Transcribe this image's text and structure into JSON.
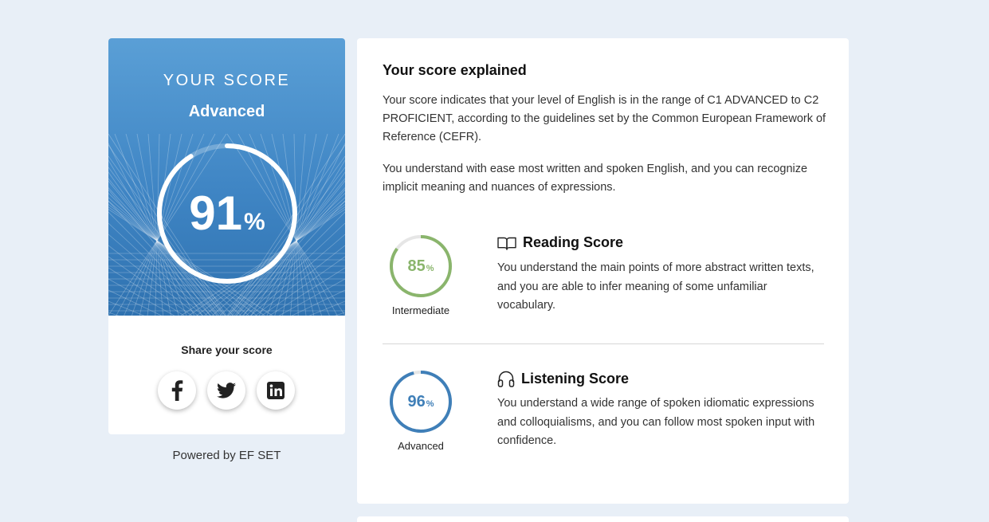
{
  "score_card": {
    "title": "YOUR SCORE",
    "level": "Advanced",
    "score": 91,
    "score_number": "91",
    "score_unit": "%",
    "ring_color": "#ffffff",
    "share_title": "Share your score",
    "share_buttons": [
      {
        "icon": "facebook-icon"
      },
      {
        "icon": "twitter-icon"
      },
      {
        "icon": "linkedin-icon"
      }
    ]
  },
  "powered_by": "Powered by EF SET",
  "explanation": {
    "title": "Your score explained",
    "paragraph1": "Your score indicates that your level of English is in the range of C1 ADVANCED to C2 PROFICIENT, according to the guidelines set by the Common European Framework of Reference (CEFR).",
    "paragraph2": "You understand with ease most written and spoken English, and you can recognize implicit meaning and nuances of expressions.",
    "sub_scores": [
      {
        "name": "Reading Score",
        "icon": "book-icon",
        "score": 85,
        "score_number": "85",
        "unit": "%",
        "level": "Intermediate",
        "color": "#8ab56c",
        "description": "You understand the main points of more abstract written texts, and you are able to infer meaning of some unfamiliar vocabulary."
      },
      {
        "name": "Listening Score",
        "icon": "headphones-icon",
        "score": 96,
        "score_number": "96",
        "unit": "%",
        "level": "Advanced",
        "color": "#3f7fb8",
        "description": "You understand a wide range of spoken idiomatic expressions and colloquialisms, and you can follow most spoken input with confidence."
      }
    ]
  }
}
